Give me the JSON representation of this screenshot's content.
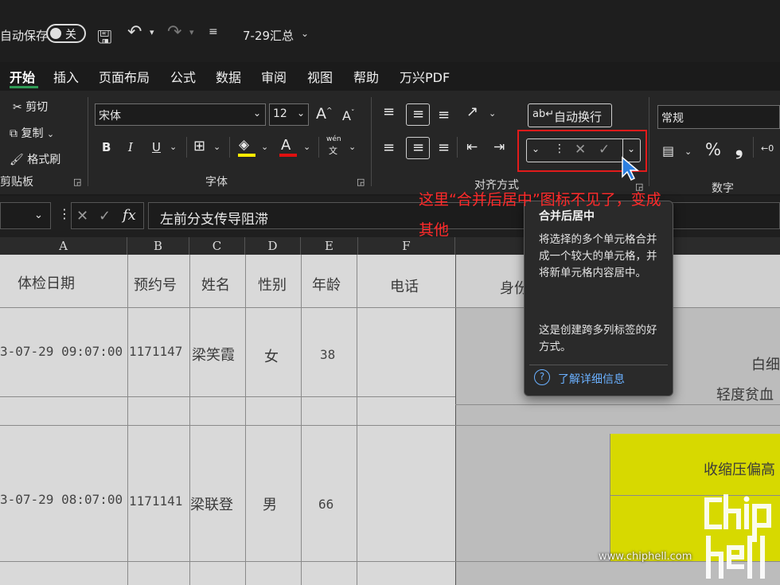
{
  "titlebar": {
    "autosave_label": "自动保存",
    "toggle_label": "关",
    "file_name": "7-29汇总"
  },
  "menu": [
    "开始",
    "插入",
    "页面布局",
    "公式",
    "数据",
    "审阅",
    "视图",
    "帮助",
    "万兴PDF"
  ],
  "clipboard": {
    "cut": "剪切",
    "copy": "复制",
    "format_painter": "格式刷",
    "group_label": "剪贴板"
  },
  "font": {
    "name": "宋体",
    "size": "12",
    "grow": "A",
    "shrink": "A",
    "bold": "B",
    "italic": "I",
    "underline": "U",
    "font_color_letter": "A",
    "phonetic_top": "wén",
    "phonetic_bottom": "文",
    "group_label": "字体"
  },
  "alignment": {
    "wrap_text": "自动换行",
    "group_label": "对齐方式"
  },
  "number": {
    "format": "常规",
    "percent": "%",
    "comma": "❟",
    "decimal_label": "←0",
    "group_label": "数字"
  },
  "formula_bar": {
    "fx": "fx",
    "content": "左前分支传导阻滞"
  },
  "columns": [
    "A",
    "B",
    "C",
    "D",
    "E",
    "F"
  ],
  "headers": [
    "体检日期",
    "预约号",
    "姓名",
    "性别",
    "年龄",
    "电话",
    "身份"
  ],
  "rows": [
    {
      "date": "3-07-29 09:07:00",
      "id": "1171147",
      "name": "梁笑霞",
      "gender": "女",
      "age": "38"
    },
    {
      "date": "3-07-29 08:07:00",
      "id": "1171141",
      "name": "梁联登",
      "gender": "男",
      "age": "66"
    }
  ],
  "right_cells": {
    "r1a": "白细",
    "r1b": "轻度贫血",
    "r2": "收缩压偏高"
  },
  "tooltip": {
    "title": "合并后居中",
    "body1": "将选择的多个单元格合并成一个较大的单元格，并将新单元格内容居中。",
    "body2": "这是创建跨多列标签的好方式。",
    "link": "了解详细信息"
  },
  "annotation": {
    "line1": "这里“合并后居中”图标不见了，变成",
    "line2": "其他"
  },
  "watermark": {
    "url": "www.chiphell.com",
    "logo": "chip hell"
  },
  "colors": {
    "accent_green": "#2f9a55",
    "annotation_red": "#ff2a2a",
    "link_blue": "#6ab0ff",
    "cell_yellow": "#d7d900"
  }
}
